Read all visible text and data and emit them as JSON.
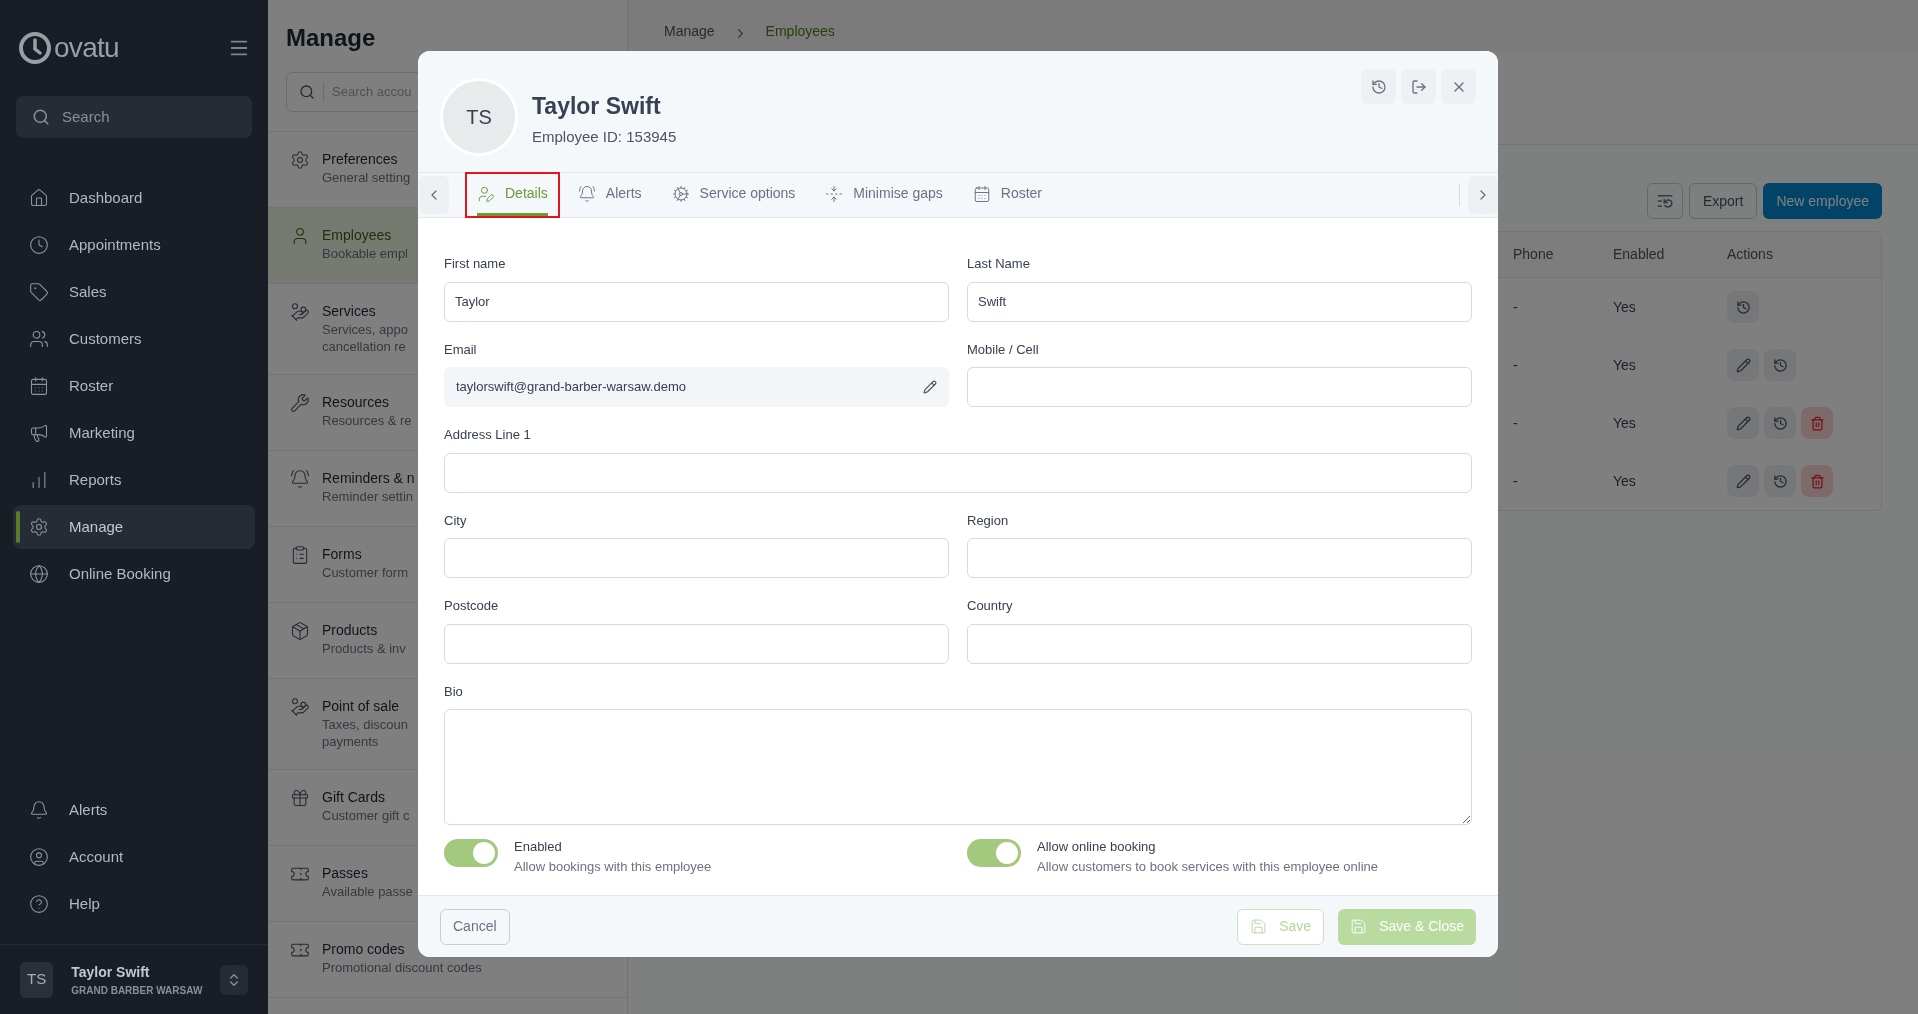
{
  "sidebar": {
    "logo": "ovatu",
    "search_placeholder": "Search",
    "items": [
      {
        "label": "Dashboard",
        "selected": false
      },
      {
        "label": "Appointments",
        "selected": false
      },
      {
        "label": "Sales",
        "selected": false
      },
      {
        "label": "Customers",
        "selected": false
      },
      {
        "label": "Roster",
        "selected": false
      },
      {
        "label": "Marketing",
        "selected": false
      },
      {
        "label": "Reports",
        "selected": false
      },
      {
        "label": "Manage",
        "selected": true
      },
      {
        "label": "Online Booking",
        "selected": false
      }
    ],
    "bottom_items": [
      {
        "label": "Alerts"
      },
      {
        "label": "Account"
      },
      {
        "label": "Help"
      }
    ],
    "user": {
      "initials": "TS",
      "name": "Taylor Swift",
      "business": "GRAND BARBER WARSAW"
    }
  },
  "manage_panel": {
    "title": "Manage",
    "search_placeholder": "Search accou",
    "items": [
      {
        "title": "Preferences",
        "lines": [
          "General setting"
        ],
        "selected": false
      },
      {
        "title": "Employees",
        "lines": [
          "Bookable empl"
        ],
        "selected": true
      },
      {
        "title": "Services",
        "lines": [
          "Services, appo",
          "cancellation re"
        ],
        "selected": false
      },
      {
        "title": "Resources",
        "lines": [
          "Resources & re"
        ],
        "selected": false
      },
      {
        "title": "Reminders & n",
        "lines": [
          "Reminder settin"
        ],
        "selected": false
      },
      {
        "title": "Forms",
        "lines": [
          "Customer form"
        ],
        "selected": false
      },
      {
        "title": "Products",
        "lines": [
          "Products & inv"
        ],
        "selected": false
      },
      {
        "title": "Point of sale",
        "lines": [
          "Taxes, discoun",
          "payments"
        ],
        "selected": false
      },
      {
        "title": "Gift Cards",
        "lines": [
          "Customer gift c"
        ],
        "selected": false
      },
      {
        "title": "Passes",
        "lines": [
          "Available passe"
        ],
        "selected": false
      },
      {
        "title": "Promo codes",
        "lines": [
          "Promotional discount codes"
        ],
        "selected": false
      }
    ]
  },
  "breadcrumb": [
    "Manage",
    "Employees"
  ],
  "toolbar": {
    "export": "Export",
    "new_employee": "New employee"
  },
  "table": {
    "columns": [
      "Phone",
      "Enabled",
      "Actions"
    ],
    "rows": [
      {
        "phone": "-",
        "enabled": "Yes",
        "actions": [
          {
            "kind": "history"
          }
        ]
      },
      {
        "phone": "-",
        "enabled": "Yes",
        "actions": [
          {
            "kind": "edit"
          },
          {
            "kind": "history"
          }
        ]
      },
      {
        "phone": "-",
        "enabled": "Yes",
        "actions": [
          {
            "kind": "edit"
          },
          {
            "kind": "history"
          },
          {
            "kind": "delete"
          }
        ]
      },
      {
        "phone": "-",
        "enabled": "Yes",
        "actions": [
          {
            "kind": "edit"
          },
          {
            "kind": "history"
          },
          {
            "kind": "delete"
          }
        ]
      }
    ]
  },
  "modal": {
    "avatar_initials": "TS",
    "name": "Taylor Swift",
    "employee_id": "Employee ID: 153945",
    "tabs": [
      {
        "label": "Details",
        "selected": true,
        "highlighted": true
      },
      {
        "label": "Alerts",
        "selected": false,
        "highlighted": false
      },
      {
        "label": "Service options",
        "selected": false,
        "highlighted": false
      },
      {
        "label": "Minimise gaps",
        "selected": false,
        "highlighted": false
      },
      {
        "label": "Roster",
        "selected": false,
        "highlighted": false
      }
    ],
    "field_rows": [
      [
        {
          "kind": "text",
          "label": "First name",
          "value": "Taylor"
        },
        {
          "kind": "text",
          "label": "Last Name",
          "value": "Swift"
        }
      ],
      [
        {
          "kind": "readonly",
          "label": "Email",
          "value": "taylorswift@grand-barber-warsaw.demo"
        },
        {
          "kind": "text",
          "label": "Mobile / Cell"
        }
      ],
      [
        {
          "kind": "text",
          "label": "Address Line 1"
        }
      ],
      [
        {
          "kind": "text",
          "label": "City"
        },
        {
          "kind": "text",
          "label": "Region"
        }
      ],
      [
        {
          "kind": "text",
          "label": "Postcode"
        },
        {
          "kind": "text",
          "label": "Country"
        }
      ],
      [
        {
          "kind": "textarea",
          "label": "Bio"
        }
      ]
    ],
    "toggles": [
      {
        "label": "Enabled",
        "description": "Allow bookings with this employee",
        "on": true
      },
      {
        "label": "Allow online booking",
        "description": "Allow customers to book services with this employee online",
        "on": true
      }
    ],
    "footer": {
      "cancel": "Cancel",
      "save": {
        "label": "Save",
        "disabled": true
      },
      "save_close": {
        "label": "Save & Close",
        "disabled": true
      }
    }
  }
}
